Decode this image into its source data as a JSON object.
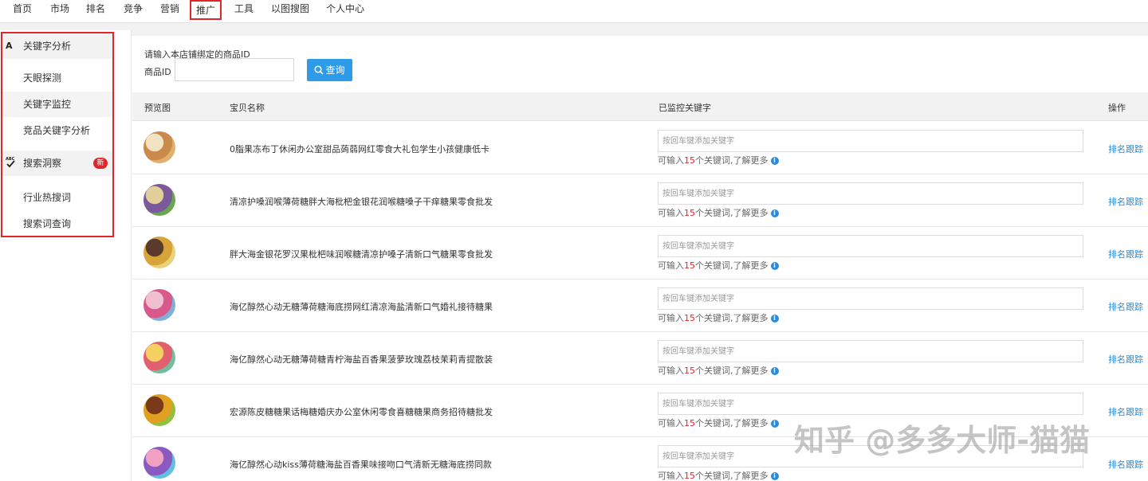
{
  "nav": {
    "tabs": [
      {
        "label": "首页",
        "active": false
      },
      {
        "label": "市场",
        "active": false
      },
      {
        "label": "排名",
        "active": false
      },
      {
        "label": "竞争",
        "active": false
      },
      {
        "label": "营销",
        "active": false
      },
      {
        "label": "推广",
        "active": true
      },
      {
        "label": "工具",
        "active": false
      },
      {
        "label": "以图搜图",
        "active": false
      },
      {
        "label": "个人中心",
        "active": false
      }
    ]
  },
  "sidebar": {
    "group1": {
      "title": "关键字分析",
      "icon": "A"
    },
    "items1": [
      "天眼探测",
      "关键字监控",
      "竞品关键字分析"
    ],
    "group2": {
      "title": "搜索洞察",
      "icon": "ABC-check",
      "badge": "新"
    },
    "items2": [
      "行业热搜词",
      "搜索词查询"
    ]
  },
  "search": {
    "hint": "请输入本店铺绑定的商品ID",
    "label": "商品ID",
    "value": "",
    "button": "查询"
  },
  "table": {
    "headers": {
      "preview": "预览图",
      "name": "宝贝名称",
      "keywords": "已监控关键字",
      "ops": "操作"
    },
    "rows": [
      {
        "name": "0脂果冻布丁休闲办公室甜品蒟蒻网红零食大礼包学生小孩健康低卡",
        "thumb_colors": [
          "#c98a4b",
          "#f3e3c3",
          "#e2b06d"
        ]
      },
      {
        "name": "清凉护嗓润喉薄荷糖胖大海枇杷金银花润喉糖嗓子干痒糖果零食批发",
        "thumb_colors": [
          "#7a5a9a",
          "#e3cf99",
          "#6aa64f"
        ]
      },
      {
        "name": "胖大海金银花罗汉果枇杷味润喉糖清凉护嗓子清新口气糖果零食批发",
        "thumb_colors": [
          "#d8a43a",
          "#5a3a2a",
          "#e9d07a"
        ]
      },
      {
        "name": "海亿醇然心动无糖薄荷糖海底捞网红清凉海盐清新口气婚礼接待糖果",
        "thumb_colors": [
          "#d95a8a",
          "#f0c0d0",
          "#7fb0d8"
        ]
      },
      {
        "name": "海亿醇然心动无糖薄荷糖青柠海盐百香果菠萝玫瑰荔枝茉莉青提散装",
        "thumb_colors": [
          "#e06070",
          "#f5d060",
          "#70c0a0"
        ]
      },
      {
        "name": "宏源陈皮糖糖果话梅糖婚庆办公室休闲零食喜糖糖果商务招待糖批发",
        "thumb_colors": [
          "#e0a020",
          "#7a3a1a",
          "#90c040"
        ]
      },
      {
        "name": "海亿醇然心动kiss薄荷糖海盐百香果味接吻口气清新无糖海底捞同款",
        "thumb_colors": [
          "#8a5ac0",
          "#f0a0c0",
          "#60c0e0"
        ]
      }
    ],
    "kw_placeholder": "按回车键添加关键字",
    "tip_prefix": "可输入",
    "tip_num": "15",
    "tip_suffix": "个关键词,了解更多",
    "op_label": "排名跟踪"
  },
  "watermark": "知乎 @多多大师-猫猫",
  "colors": {
    "accent": "#2d9be8",
    "highlight": "#e0262b",
    "link": "#2d8ad6"
  }
}
